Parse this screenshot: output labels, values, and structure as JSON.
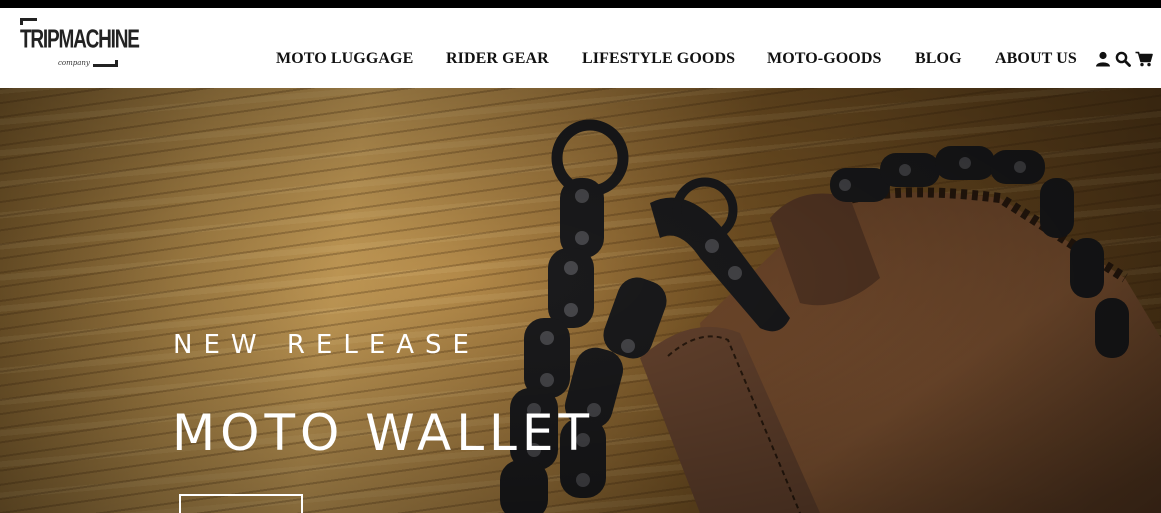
{
  "brand": {
    "logo_text": "TRIPMACHINE",
    "logo_subtext": "company"
  },
  "nav": {
    "items": [
      {
        "label": "MOTO LUGGAGE"
      },
      {
        "label": "RIDER GEAR"
      },
      {
        "label": "LIFESTYLE GOODS"
      },
      {
        "label": "MOTO-GOODS"
      },
      {
        "label": "BLOG"
      },
      {
        "label": "ABOUT US"
      }
    ],
    "icons": [
      "user-icon",
      "search-icon",
      "cart-icon"
    ]
  },
  "hero": {
    "eyebrow": "NEW RELEASE",
    "title": "MOTO WALLET",
    "image": "leather wallet with black bike-chain strap on wooden surface"
  },
  "colors": {
    "topbar": "#000000",
    "header_bg": "#ffffff",
    "nav_text": "#111111",
    "hero_text": "#ffffff"
  }
}
